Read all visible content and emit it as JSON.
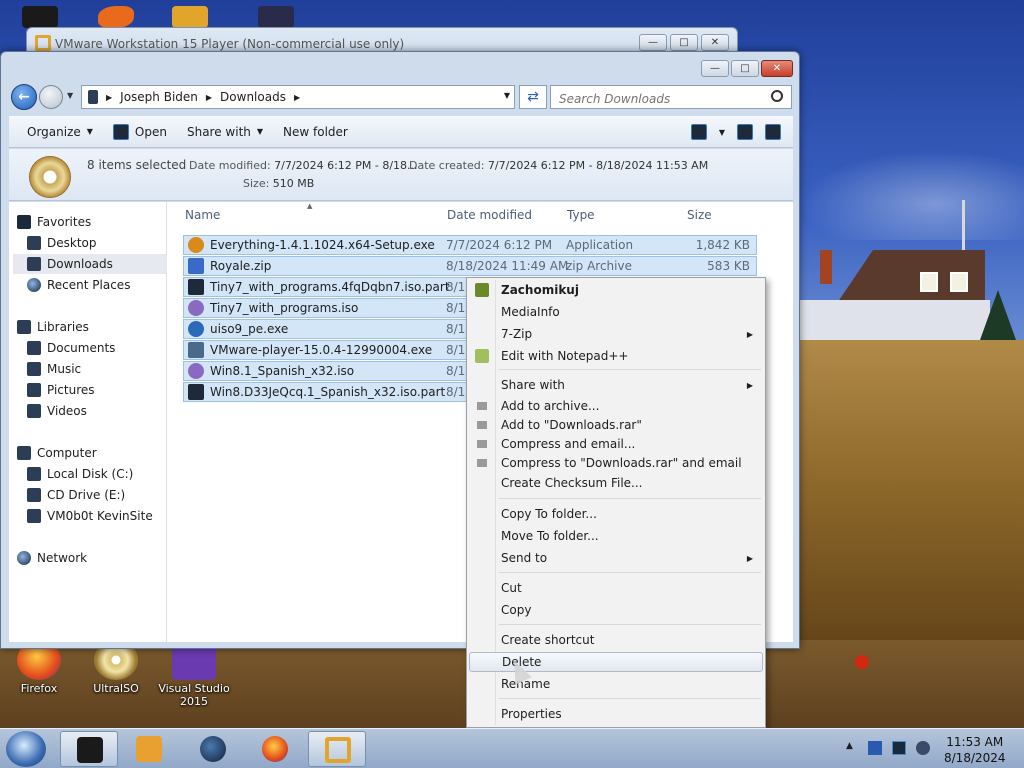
{
  "desktop": {
    "icons": [
      {
        "label": "Firefox"
      },
      {
        "label": "UltraISO"
      },
      {
        "label": "Visual Studio 2015"
      }
    ]
  },
  "vmware_window": {
    "title": "VMware Workstation 15 Player (Non-commercial use only)"
  },
  "explorer": {
    "breadcrumb": [
      "Joseph Biden",
      "Downloads"
    ],
    "search_placeholder": "Search Downloads",
    "toolbar": {
      "organize": "Organize",
      "open": "Open",
      "share_with": "Share with",
      "new_folder": "New folder"
    },
    "details": {
      "count": "8 items selected",
      "date_modified_label": "Date modified:",
      "date_modified_value": "7/7/2024 6:12 PM - 8/18...",
      "date_created_label": "Date created:",
      "date_created_value": "7/7/2024 6:12 PM - 8/18/2024 11:53 AM",
      "size_label": "Size:",
      "size_value": "510 MB"
    },
    "nav": {
      "favorites": "Favorites",
      "desktop": "Desktop",
      "downloads": "Downloads",
      "recent": "Recent Places",
      "libraries": "Libraries",
      "documents": "Documents",
      "music": "Music",
      "pictures": "Pictures",
      "videos": "Videos",
      "computer": "Computer",
      "local_disk": "Local Disk (C:)",
      "cd_drive": "CD Drive (E:)",
      "vm": "VM0b0t KevinSite",
      "network": "Network"
    },
    "columns": {
      "name": "Name",
      "date_modified": "Date modified",
      "type": "Type",
      "size": "Size"
    },
    "files": [
      {
        "name": "Everything-1.4.1.1024.x64-Setup.exe",
        "date": "7/7/2024 6:12 PM",
        "type": "Application",
        "size": "1,842 KB",
        "icon": "magnifier-icon",
        "color": "#d98a1a"
      },
      {
        "name": "Royale.zip",
        "date": "8/18/2024 11:49 AM",
        "type": "zip Archive",
        "size": "583 KB",
        "icon": "zip-icon",
        "color": "#3a6ac8"
      },
      {
        "name": "Tiny7_with_programs.4fqDqbn7.iso.part",
        "date": "8/18",
        "type": "",
        "size": "",
        "icon": "part-file-icon",
        "color": "#1e2a3a"
      },
      {
        "name": "Tiny7_with_programs.iso",
        "date": "8/18",
        "type": "",
        "size": "",
        "icon": "disc-image-icon",
        "color": "#8a6ac0"
      },
      {
        "name": "uiso9_pe.exe",
        "date": "8/18",
        "type": "",
        "size": "",
        "icon": "globe-icon",
        "color": "#2a6ab8"
      },
      {
        "name": "VMware-player-15.0.4-12990004.exe",
        "date": "8/18",
        "type": "",
        "size": "",
        "icon": "installer-icon",
        "color": "#4a6a8a"
      },
      {
        "name": "Win8.1_Spanish_x32.iso",
        "date": "8/18",
        "type": "",
        "size": "",
        "icon": "disc-image-icon",
        "color": "#8a6ac0"
      },
      {
        "name": "Win8.D33JeQcq.1_Spanish_x32.iso.part",
        "date": "8/18",
        "type": "",
        "size": "",
        "icon": "part-file-icon",
        "color": "#1e2a3a"
      }
    ]
  },
  "context_menu": {
    "items": [
      {
        "label": "Zachomikuj"
      },
      {
        "label": "MediaInfo"
      },
      {
        "label": "7-Zip"
      },
      {
        "label": "Edit with Notepad++"
      },
      {
        "label": "Share with"
      },
      {
        "label": "Add to archive..."
      },
      {
        "label": "Add to \"Downloads.rar\""
      },
      {
        "label": "Compress and email..."
      },
      {
        "label": "Compress to \"Downloads.rar\" and email"
      },
      {
        "label": "Create Checksum File..."
      },
      {
        "label": "Copy To folder..."
      },
      {
        "label": "Move To folder..."
      },
      {
        "label": "Send to"
      },
      {
        "label": "Cut"
      },
      {
        "label": "Copy"
      },
      {
        "label": "Create shortcut"
      },
      {
        "label": "Delete"
      },
      {
        "label": "Rename"
      },
      {
        "label": "Properties"
      }
    ]
  },
  "taskbar": {
    "time": "11:53 AM",
    "date": "8/18/2024"
  }
}
